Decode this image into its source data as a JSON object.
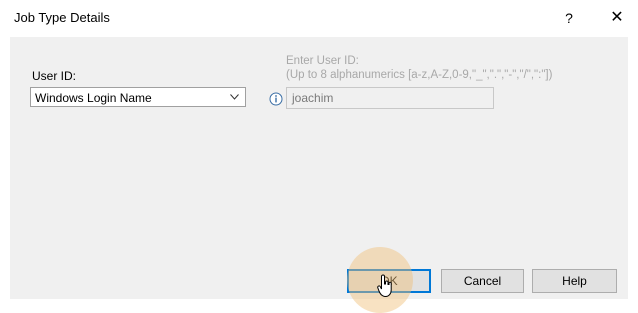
{
  "window": {
    "title": "Job Type Details",
    "help_glyph": "?",
    "close_glyph": "✕"
  },
  "form": {
    "userid_label": "User ID:",
    "select": {
      "value": "Windows Login Name",
      "icon": "chevron-down-icon"
    },
    "hint_line1": "Enter User ID:",
    "hint_line2": "(Up to 8 alphanumerics [a-z,A-Z,0-9,\"_\",\".\",\"-\",\"/\",\":\"])",
    "info_icon": "info-icon",
    "input_value": "joachim"
  },
  "buttons": {
    "ok": "OK",
    "cancel": "Cancel",
    "help": "Help"
  },
  "colors": {
    "accent": "#0078d7",
    "panel_bg": "#f0f0f0",
    "hint_text": "#a8a8a8",
    "click_highlight": "#f0be78"
  }
}
